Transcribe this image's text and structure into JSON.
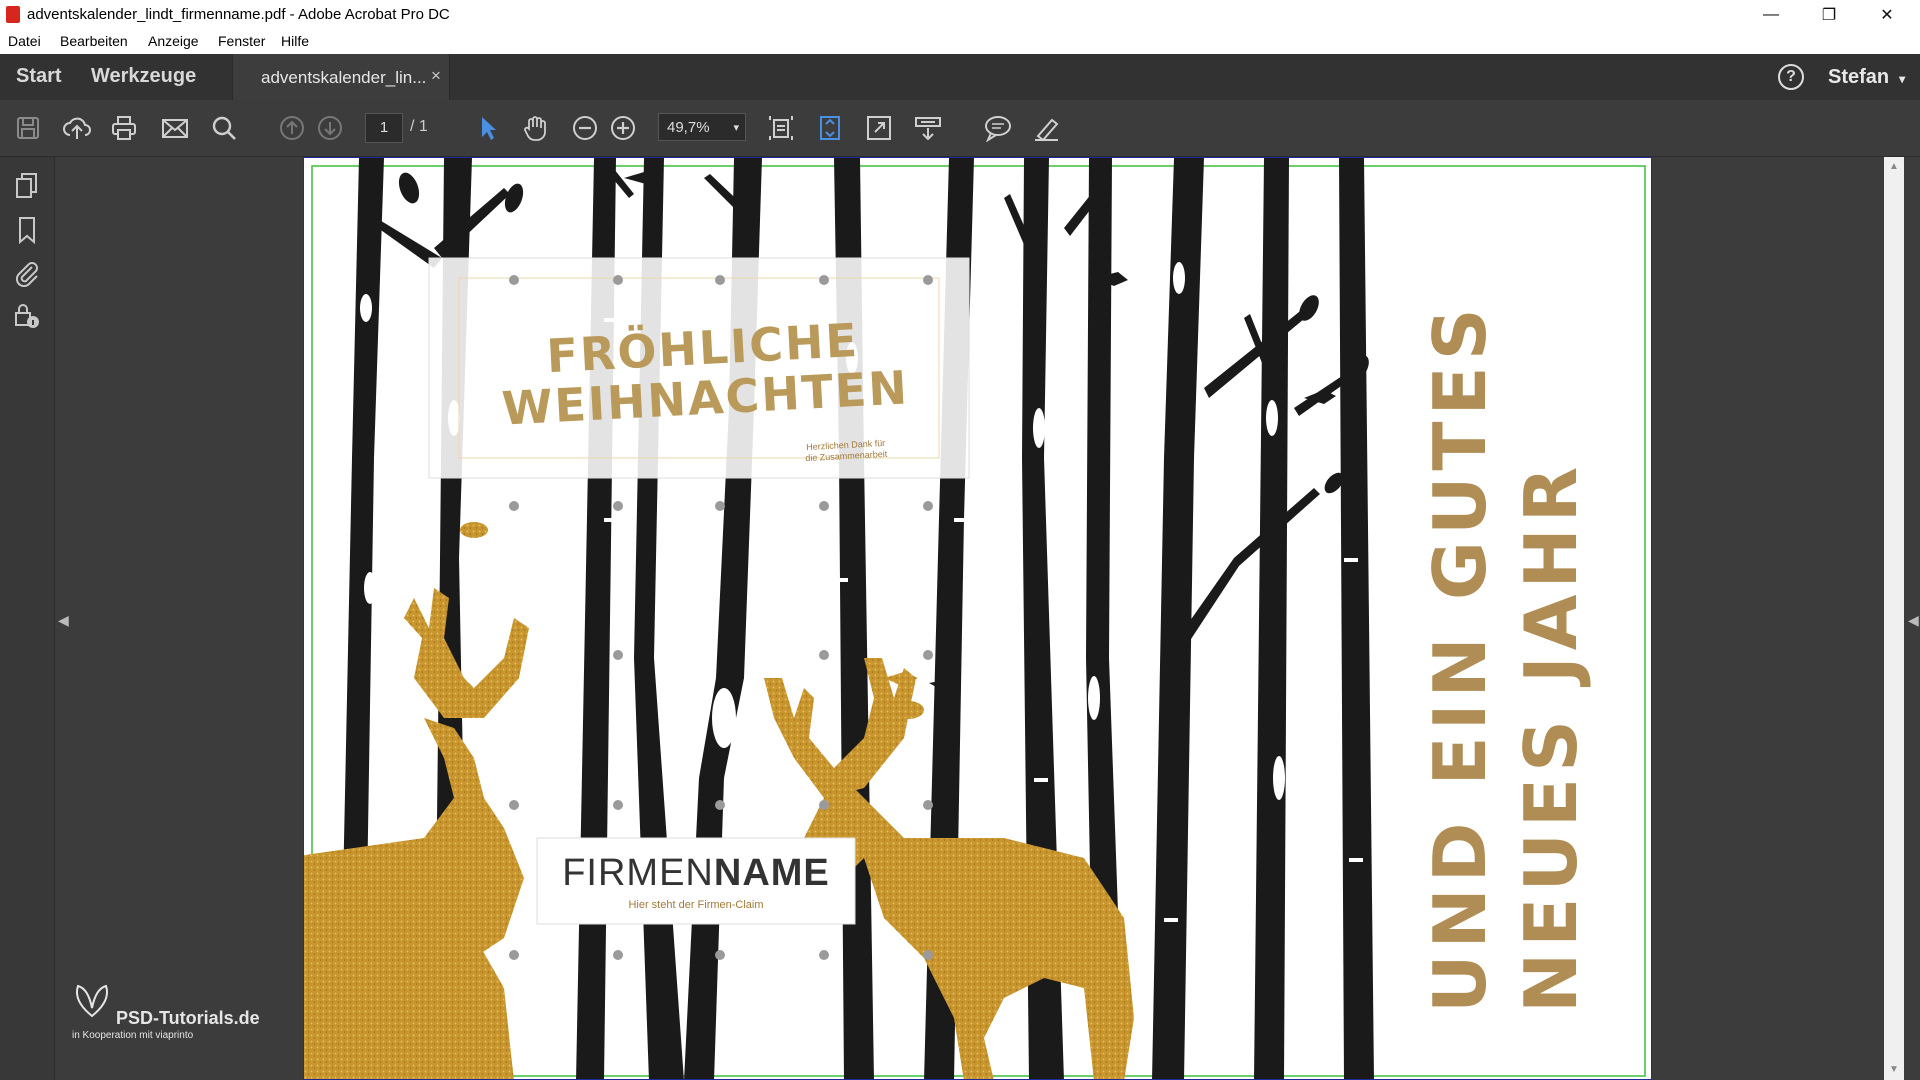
{
  "window": {
    "title": "adventskalender_lindt_firmenname.pdf - Adobe Acrobat Pro DC",
    "minimize_icon": "minimize-icon",
    "maximize_icon": "restore-icon",
    "close_icon": "close-icon"
  },
  "menu": [
    "Datei",
    "Bearbeiten",
    "Anzeige",
    "Fenster",
    "Hilfe"
  ],
  "tabs": {
    "start": "Start",
    "tools": "Werkzeuge",
    "document": "adventskalender_lin...",
    "document_close": "×"
  },
  "account": {
    "help": "?",
    "user": "Stefan",
    "caret": "▾"
  },
  "toolbar": {
    "page_current": "1",
    "page_total": "/ 1",
    "zoom": "49,7%",
    "zoom_caret": "▾",
    "icons": [
      "save-icon",
      "cloud-upload-icon",
      "print-icon",
      "mail-icon",
      "search-icon",
      "page-up-icon",
      "page-down-icon",
      "select-arrow-icon",
      "hand-icon",
      "zoom-out-icon",
      "zoom-in-icon",
      "fit-page-icon",
      "scroll-mode-icon",
      "full-screen-icon",
      "read-mode-icon",
      "comment-icon",
      "highlight-pen-icon"
    ]
  },
  "left_rail": {
    "icons": [
      "pages-icon",
      "bookmark-icon",
      "attachment-icon",
      "security-icon"
    ]
  },
  "document": {
    "card_title_line1": "FRÖHLICHE",
    "card_title_line2": "WEIHNACHTEN",
    "card_thanks_line1": "Herzlichen Dank für",
    "card_thanks_line2": "die Zusammenarbeit",
    "company_light": "FIRMEN",
    "company_bold": "NAME",
    "claim": "Hier steht der Firmen-Claim",
    "greeting_line1": "UND EIN GUTES",
    "greeting_line2": "NEUES JAHR",
    "colors": {
      "gold": "#c9962e",
      "tree": "#1a1a1a",
      "guide": "#3bbf3b"
    }
  },
  "watermark": {
    "brand": "PSD-Tutorials.de",
    "sub": "in Kooperation mit viaprinto"
  }
}
